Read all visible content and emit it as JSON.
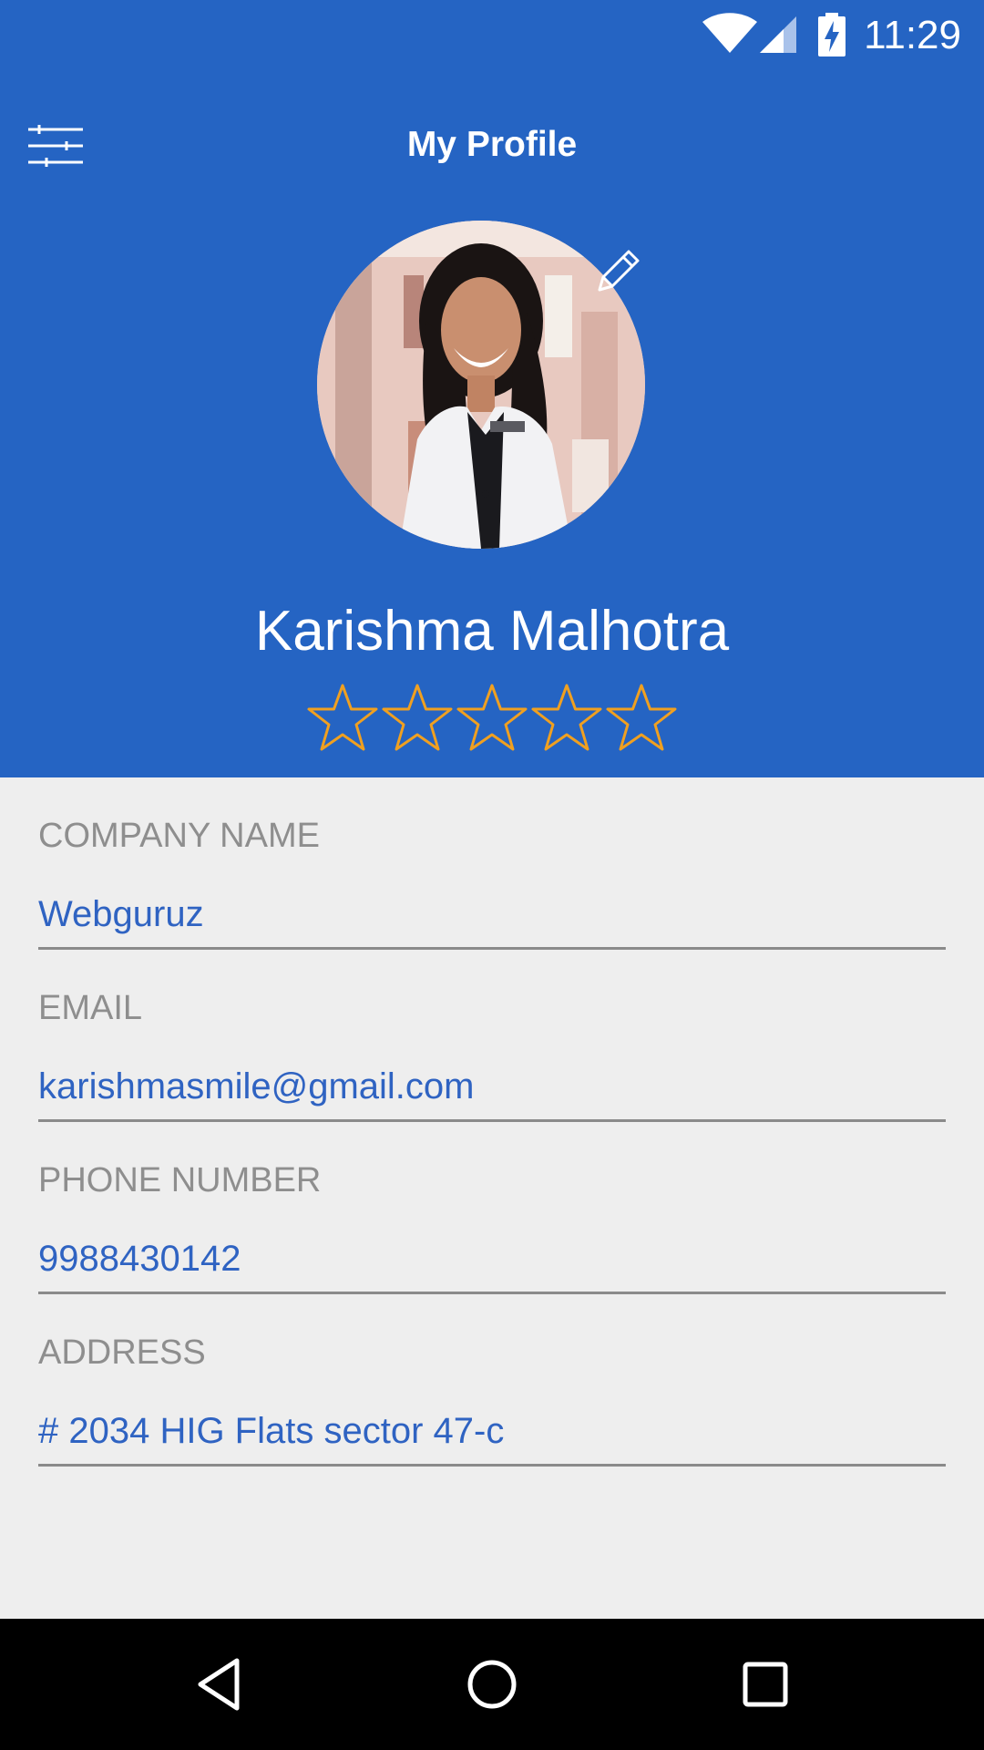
{
  "status_bar": {
    "time": "11:29",
    "icons": [
      "wifi-icon",
      "cellular-signal-icon",
      "battery-charging-icon"
    ]
  },
  "toolbar": {
    "title": "My Profile",
    "menu_icon": "filter-sliders-icon"
  },
  "profile": {
    "name": "Karishma Malhotra",
    "edit_icon": "pencil-icon",
    "rating": 0,
    "rating_max": 5
  },
  "fields": [
    {
      "label": "COMPANY NAME",
      "value": "Webguruz"
    },
    {
      "label": "EMAIL",
      "value": "karishmasmile@gmail.com"
    },
    {
      "label": "PHONE NUMBER",
      "value": "9988430142"
    },
    {
      "label": "ADDRESS",
      "value": "# 2034 HIG Flats sector 47-c"
    }
  ],
  "nav_bar": {
    "icons": [
      "back-icon",
      "home-icon",
      "recents-icon"
    ]
  },
  "colors": {
    "header_bg": "#2564c3",
    "value_text": "#2f63c2",
    "label_text": "#8e8e8e",
    "star_outline": "#f0a020",
    "page_bg": "#eeeeee"
  }
}
